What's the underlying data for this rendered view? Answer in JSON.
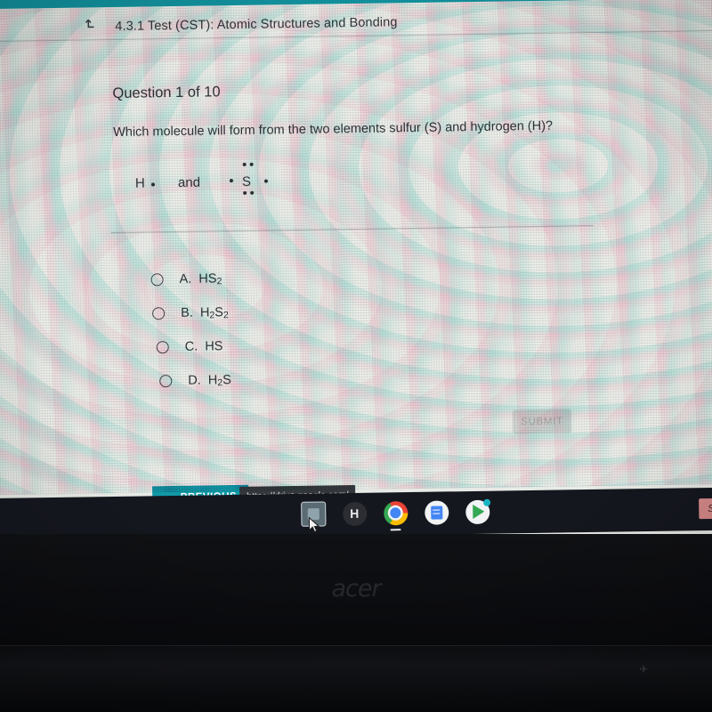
{
  "header": {
    "back_icon": "return-up-arrow-icon",
    "title": "4.3.1  Test (CST):  Atomic Structures and Bonding"
  },
  "question": {
    "counter": "Question 1 of 10",
    "prompt": "Which molecule will form from the two elements sulfur (S) and hydrogen (H)?",
    "lewis": {
      "hydrogen_symbol": "H",
      "conjunction": "and",
      "sulfur_symbol": "S"
    }
  },
  "options": [
    {
      "letter": "A.",
      "formula_html": "HS<sub>2</sub>",
      "selected": false
    },
    {
      "letter": "B.",
      "formula_html": "H<sub>2</sub>S<sub>2</sub>",
      "selected": false
    },
    {
      "letter": "C.",
      "formula_html": "HS",
      "selected": false
    },
    {
      "letter": "D.",
      "formula_html": "H<sub>2</sub>S",
      "selected": false
    }
  ],
  "actions": {
    "submit_label": "SUBMIT",
    "submit_disabled": true,
    "previous_label": "PREVIOUS",
    "previous_arrow": "arrow-left-icon"
  },
  "status_bar": {
    "url": "https://drive.google.com/"
  },
  "shelf": {
    "items": [
      {
        "name": "launcher-icon",
        "label": ""
      },
      {
        "name": "hapara-h-icon",
        "label": "H"
      },
      {
        "name": "chrome-icon",
        "label": ""
      },
      {
        "name": "google-docs-icon",
        "label": ""
      },
      {
        "name": "play-store-icon",
        "label": ""
      }
    ],
    "signin_label": "Sign"
  },
  "device": {
    "brand": "acer"
  },
  "colors": {
    "app_bar_teal": "#12929e",
    "previous_teal": "#109aa8",
    "submit_disabled_bg": "#d2d5d1",
    "shelf_bg": "#15171f",
    "text": "#2f3438"
  }
}
